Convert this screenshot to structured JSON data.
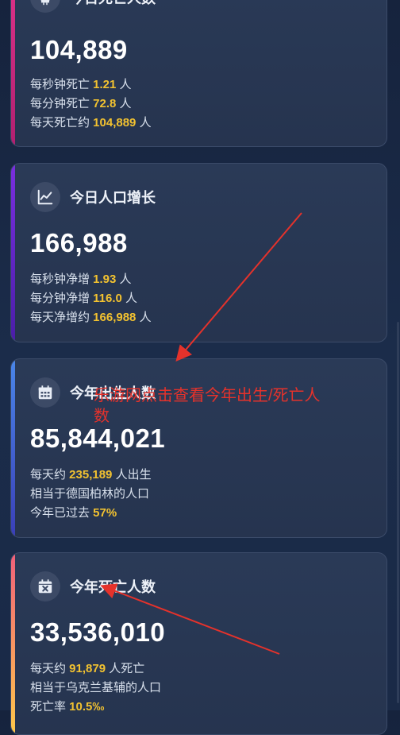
{
  "cards": [
    {
      "title": "今日死亡人数",
      "value": "104,889",
      "lines": [
        {
          "pre": "每秒钟死亡 ",
          "hl": "1.21",
          "post": " 人"
        },
        {
          "pre": "每分钟死亡 ",
          "hl": "72.8",
          "post": " 人"
        },
        {
          "pre": "每天死亡约 ",
          "hl": "104,889",
          "post": " 人"
        }
      ],
      "icon": "skull-icon",
      "accent": "#d6337f"
    },
    {
      "title": "今日人口增长",
      "value": "166,988",
      "lines": [
        {
          "pre": "每秒钟净增 ",
          "hl": "1.93",
          "post": " 人"
        },
        {
          "pre": "每分钟净增 ",
          "hl": "116.0",
          "post": " 人"
        },
        {
          "pre": "每天净增约 ",
          "hl": "166,988",
          "post": " 人"
        }
      ],
      "icon": "chart-line-icon",
      "accent": "#6a2bd1"
    },
    {
      "title": "今年出生人数",
      "value": "85,844,021",
      "lines": [
        {
          "pre": "每天约 ",
          "hl": "235,189",
          "post": " 人出生"
        },
        {
          "pre": "相当于德国柏林的人口",
          "hl": "",
          "post": ""
        },
        {
          "pre": "今年已过去 ",
          "hl": "57%",
          "post": ""
        }
      ],
      "icon": "calendar-icon",
      "accent": "#3f6fd8"
    },
    {
      "title": "今年死亡人数",
      "value": "33,536,010",
      "lines": [
        {
          "pre": "每天约 ",
          "hl": "91,879",
          "post": " 人死亡"
        },
        {
          "pre": "相当于乌克兰基辅的人口",
          "hl": "",
          "post": ""
        },
        {
          "pre": "死亡率 ",
          "hl": "10.5‰",
          "post": ""
        }
      ],
      "icon": "calendar-x-icon",
      "accent": "#f7a548"
    }
  ],
  "annotation": {
    "text": "乐游网点击查看今年出生/死亡人数",
    "color": "#e5322b"
  },
  "highlight_color": "#f2c230"
}
